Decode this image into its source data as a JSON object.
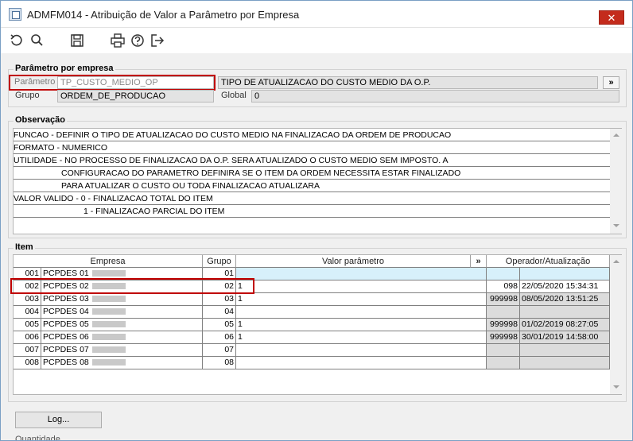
{
  "window": {
    "title": "ADMFM014 - Atribuição de Valor a Parâmetro por Empresa",
    "close_symbol": "✕"
  },
  "toolbar": {
    "icons": [
      "refresh-icon",
      "search-icon",
      "save-icon",
      "print-icon",
      "help-icon",
      "exit-icon"
    ]
  },
  "parametro": {
    "section_title": "Parâmetro por empresa",
    "param_label": "Parâmetro",
    "param_value": "TP_CUSTO_MEDIO_OP",
    "description": "TIPO DE ATUALIZACAO DO CUSTO MEDIO DA O.P.",
    "expand_label": "»",
    "grupo_label": "Grupo",
    "grupo_value": "ORDEM_DE_PRODUCAO",
    "global_label": "Global",
    "global_value": "0"
  },
  "observacao": {
    "section_title": "Observação",
    "lines": [
      "FUNCAO - DEFINIR O TIPO DE ATUALIZACAO DO CUSTO MEDIO NA FINALIZACAO DA ORDEM DE PRODUCAO",
      "FORMATO - NUMERICO",
      "UTILIDADE - NO PROCESSO DE FINALIZACAO DA O.P. SERA ATUALIZADO O CUSTO MEDIO SEM IMPOSTO. A",
      "                    CONFIGURACAO DO PARAMETRO DEFINIRA SE O ITEM DA ORDEM NECESSITA ESTAR FINALIZADO",
      "                    PARA ATUALIZAR O CUSTO OU TODA FINALIZACAO ATUALIZARA",
      "VALOR VALIDO - 0 - FINALIZACAO TOTAL DO ITEM",
      "                           1 - FINALIZACAO PARCIAL DO ITEM",
      ""
    ]
  },
  "item": {
    "section_title": "Item",
    "columns": {
      "empresa": "Empresa",
      "grupo": "Grupo",
      "valor": "Valor parâmetro",
      "expand": "»",
      "operador": "Operador/Atualização"
    },
    "rows": [
      {
        "num": "001",
        "empresa": "PCPDES 01",
        "grupo": "01",
        "valor": "",
        "operador": "",
        "data": ""
      },
      {
        "num": "002",
        "empresa": "PCPDES 02",
        "grupo": "02",
        "valor": "1",
        "operador": "098",
        "data": "22/05/2020 15:34:31"
      },
      {
        "num": "003",
        "empresa": "PCPDES 03",
        "grupo": "03",
        "valor": "1",
        "operador": "999998",
        "data": "08/05/2020 13:51:25"
      },
      {
        "num": "004",
        "empresa": "PCPDES 04",
        "grupo": "04",
        "valor": "",
        "operador": "",
        "data": ""
      },
      {
        "num": "005",
        "empresa": "PCPDES 05",
        "grupo": "05",
        "valor": "1",
        "operador": "999998",
        "data": "01/02/2019 08:27:05"
      },
      {
        "num": "006",
        "empresa": "PCPDES 06",
        "grupo": "06",
        "valor": "1",
        "operador": "999998",
        "data": "30/01/2019 14:58:00"
      },
      {
        "num": "007",
        "empresa": "PCPDES 07",
        "grupo": "07",
        "valor": "",
        "operador": "",
        "data": ""
      },
      {
        "num": "008",
        "empresa": "PCPDES 08",
        "grupo": "08",
        "valor": "",
        "operador": "",
        "data": ""
      }
    ]
  },
  "footer": {
    "log_label": "Log...",
    "cut_text": "Quantidade"
  }
}
